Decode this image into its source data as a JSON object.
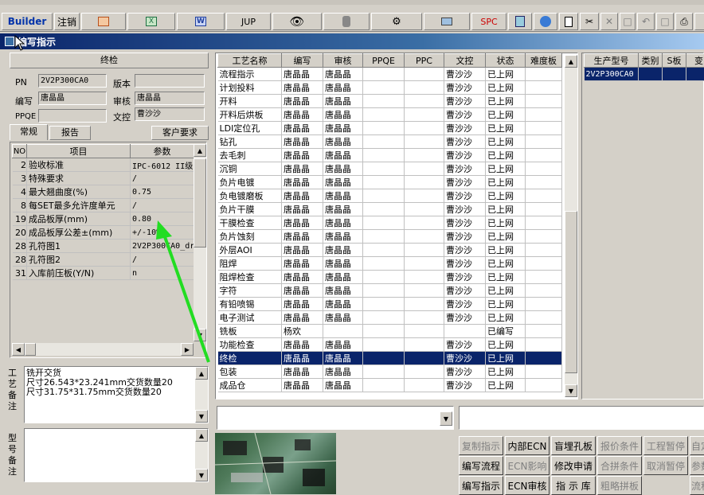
{
  "toolbar": {
    "builder": "Builder",
    "logout": "注销",
    "jup": "JUP",
    "spc": "SPC"
  },
  "window": {
    "title": "编写指示"
  },
  "left": {
    "header": "终检",
    "pn_label": "PN",
    "pn_value": "2V2P300CA0",
    "version_label": "版本",
    "version_value": "",
    "writer_label": "编写",
    "writer_value": "唐晶晶",
    "reviewer_label": "审核",
    "reviewer_value": "唐晶晶",
    "ppqe_label": "PPQE",
    "ppqe_value": "",
    "doc_control_label": "文控",
    "doc_control_value": "曹沙沙",
    "tabs": [
      "常规",
      "报告",
      "客户要求"
    ],
    "param_headers": [
      "NO",
      "项目",
      "参数"
    ],
    "params": [
      {
        "no": "2",
        "item": "验收标准",
        "value": "IPC-6012 II级"
      },
      {
        "no": "3",
        "item": "特殊要求",
        "value": "/"
      },
      {
        "no": "4",
        "item": "最大翘曲度(%)",
        "value": "0.75"
      },
      {
        "no": "8",
        "item": "每SET最多允许度单元",
        "value": "/"
      },
      {
        "no": "19",
        "item": "成品板厚(mm)",
        "value": "0.80"
      },
      {
        "no": "20",
        "item": "成品板厚公差±(mm)",
        "value": "+/-10%"
      },
      {
        "no": "28",
        "item": "孔符图1",
        "value": "2V2P300CA0_dr"
      },
      {
        "no": "28",
        "item": "孔符图2",
        "value": "/"
      },
      {
        "no": "31",
        "item": "入库前压板(Y/N)",
        "value": "n"
      }
    ],
    "process_note_label": "工艺备注",
    "process_note_lines": [
      "铣开交货",
      "尺寸26.543*23.241mm交货数量20",
      "尺寸31.75*31.75mm交货数量20"
    ],
    "model_note_label": "型号备注"
  },
  "steps": {
    "headers": [
      "工艺名称",
      "编写",
      "审核",
      "PPQE",
      "PPC",
      "文控",
      "状态",
      "难度板"
    ],
    "rows": [
      {
        "name": "流程指示",
        "w": "唐晶晶",
        "r": "唐晶晶",
        "p": "",
        "c": "",
        "d": "曹沙沙",
        "s": "已上网"
      },
      {
        "name": "计划投料",
        "w": "唐晶晶",
        "r": "唐晶晶",
        "p": "",
        "c": "",
        "d": "曹沙沙",
        "s": "已上网"
      },
      {
        "name": "开料",
        "w": "唐晶晶",
        "r": "唐晶晶",
        "p": "",
        "c": "",
        "d": "曹沙沙",
        "s": "已上网"
      },
      {
        "name": "开料后烘板",
        "w": "唐晶晶",
        "r": "唐晶晶",
        "p": "",
        "c": "",
        "d": "曹沙沙",
        "s": "已上网"
      },
      {
        "name": "LDI定位孔",
        "w": "唐晶晶",
        "r": "唐晶晶",
        "p": "",
        "c": "",
        "d": "曹沙沙",
        "s": "已上网"
      },
      {
        "name": "钻孔",
        "w": "唐晶晶",
        "r": "唐晶晶",
        "p": "",
        "c": "",
        "d": "曹沙沙",
        "s": "已上网"
      },
      {
        "name": "去毛刺",
        "w": "唐晶晶",
        "r": "唐晶晶",
        "p": "",
        "c": "",
        "d": "曹沙沙",
        "s": "已上网"
      },
      {
        "name": "沉铜",
        "w": "唐晶晶",
        "r": "唐晶晶",
        "p": "",
        "c": "",
        "d": "曹沙沙",
        "s": "已上网"
      },
      {
        "name": "负片电镀",
        "w": "唐晶晶",
        "r": "唐晶晶",
        "p": "",
        "c": "",
        "d": "曹沙沙",
        "s": "已上网"
      },
      {
        "name": "负电镀磨板",
        "w": "唐晶晶",
        "r": "唐晶晶",
        "p": "",
        "c": "",
        "d": "曹沙沙",
        "s": "已上网"
      },
      {
        "name": "负片干膜",
        "w": "唐晶晶",
        "r": "唐晶晶",
        "p": "",
        "c": "",
        "d": "曹沙沙",
        "s": "已上网"
      },
      {
        "name": "干膜检查",
        "w": "唐晶晶",
        "r": "唐晶晶",
        "p": "",
        "c": "",
        "d": "曹沙沙",
        "s": "已上网"
      },
      {
        "name": "负片蚀刻",
        "w": "唐晶晶",
        "r": "唐晶晶",
        "p": "",
        "c": "",
        "d": "曹沙沙",
        "s": "已上网"
      },
      {
        "name": "外层AOI",
        "w": "唐晶晶",
        "r": "唐晶晶",
        "p": "",
        "c": "",
        "d": "曹沙沙",
        "s": "已上网"
      },
      {
        "name": "阻焊",
        "w": "唐晶晶",
        "r": "唐晶晶",
        "p": "",
        "c": "",
        "d": "曹沙沙",
        "s": "已上网"
      },
      {
        "name": "阻焊检查",
        "w": "唐晶晶",
        "r": "唐晶晶",
        "p": "",
        "c": "",
        "d": "曹沙沙",
        "s": "已上网"
      },
      {
        "name": "字符",
        "w": "唐晶晶",
        "r": "唐晶晶",
        "p": "",
        "c": "",
        "d": "曹沙沙",
        "s": "已上网"
      },
      {
        "name": "有铅喷锡",
        "w": "唐晶晶",
        "r": "唐晶晶",
        "p": "",
        "c": "",
        "d": "曹沙沙",
        "s": "已上网"
      },
      {
        "name": "电子测试",
        "w": "唐晶晶",
        "r": "唐晶晶",
        "p": "",
        "c": "",
        "d": "曹沙沙",
        "s": "已上网"
      },
      {
        "name": "铣板",
        "w": "杨欢",
        "r": "",
        "p": "",
        "c": "",
        "d": "",
        "s": "已编写"
      },
      {
        "name": "功能检查",
        "w": "唐晶晶",
        "r": "唐晶晶",
        "p": "",
        "c": "",
        "d": "曹沙沙",
        "s": "已上网"
      },
      {
        "name": "终检",
        "w": "唐晶晶",
        "r": "唐晶晶",
        "p": "",
        "c": "",
        "d": "曹沙沙",
        "s": "已上网",
        "sel": true
      },
      {
        "name": "包装",
        "w": "唐晶晶",
        "r": "唐晶晶",
        "p": "",
        "c": "",
        "d": "曹沙沙",
        "s": "已上网"
      },
      {
        "name": "成品仓",
        "w": "唐晶晶",
        "r": "唐晶晶",
        "p": "",
        "c": "",
        "d": "曹沙沙",
        "s": "已上网"
      }
    ]
  },
  "models": {
    "headers": [
      "生产型号",
      "类别",
      "S板",
      "变"
    ],
    "rows": [
      {
        "model": "2V2P300CA0"
      }
    ]
  },
  "buttons": [
    [
      "复制指示",
      "内部ECN",
      "盲埋孔板",
      "报价条件",
      "工程暂停",
      "自定义"
    ],
    [
      "编写流程",
      "ECN影响",
      "修改申请",
      "合拼条件",
      "取消暂停",
      "参数检"
    ],
    [
      "编写指示",
      "ECN审核",
      "指 示 库",
      "粗略拼板",
      "",
      "流程检"
    ]
  ],
  "buttons_disabled": [
    [
      true,
      false,
      false,
      true,
      true,
      true
    ],
    [
      false,
      true,
      false,
      true,
      true,
      true
    ],
    [
      false,
      false,
      false,
      true,
      false,
      true
    ]
  ],
  "colors": {
    "selection": "#0a246a",
    "arrow": "#22dd22",
    "title_start": "#0a246a"
  }
}
